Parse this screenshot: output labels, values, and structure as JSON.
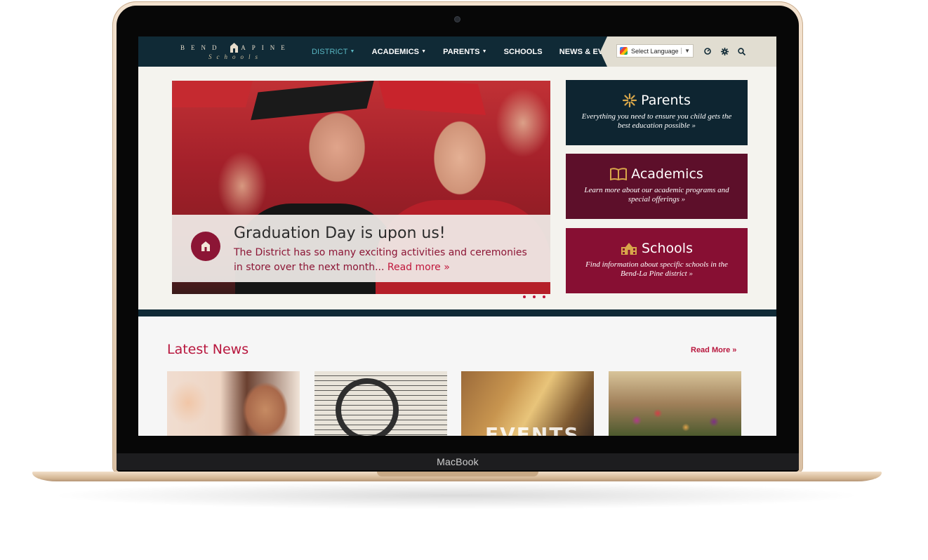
{
  "device": {
    "label": "MacBook"
  },
  "site": {
    "logo": {
      "top_text": "BEND LAPINE",
      "sub_text": "Schools"
    },
    "nav": {
      "items": [
        {
          "label": "DISTRICT",
          "has_dropdown": true,
          "active": true
        },
        {
          "label": "ACADEMICS",
          "has_dropdown": true
        },
        {
          "label": "PARENTS",
          "has_dropdown": true
        },
        {
          "label": "SCHOOLS",
          "has_dropdown": false
        },
        {
          "label": "NEWS & EVENTS",
          "has_dropdown": true
        }
      ],
      "language_select": {
        "value": "Select Language"
      },
      "icons": [
        "dashboard-icon",
        "gear-icon",
        "search-icon"
      ]
    },
    "hero": {
      "title": "Graduation Day is upon us!",
      "body": "The District has so many exciting activities and ceremonies in store over the next month...",
      "link": "Read more »",
      "slides": 3
    },
    "tiles": [
      {
        "title": "Parents",
        "desc": "Everything you need to ensure you child gets the best education possible »",
        "icon": "sunburst-icon",
        "color": "#0e2531"
      },
      {
        "title": "Academics",
        "desc": "Learn more about our academic programs and special offerings »",
        "icon": "book-icon",
        "color": "#5d0f2a"
      },
      {
        "title": "Schools",
        "desc": "Find information about specific schools in the Bend-La Pine district »",
        "icon": "school-building-icon",
        "color": "#870f33"
      }
    ],
    "news": {
      "title": "Latest News",
      "read_more": "Read More »",
      "thumbs": [
        {
          "name": "students-photo"
        },
        {
          "name": "music-photo"
        },
        {
          "name": "events-photo",
          "label": "EVENTS"
        },
        {
          "name": "flowers-photo"
        }
      ]
    }
  },
  "colors": {
    "nav_bg": "#102a36",
    "accent": "#b8163d",
    "active_nav": "#58b6c2"
  }
}
